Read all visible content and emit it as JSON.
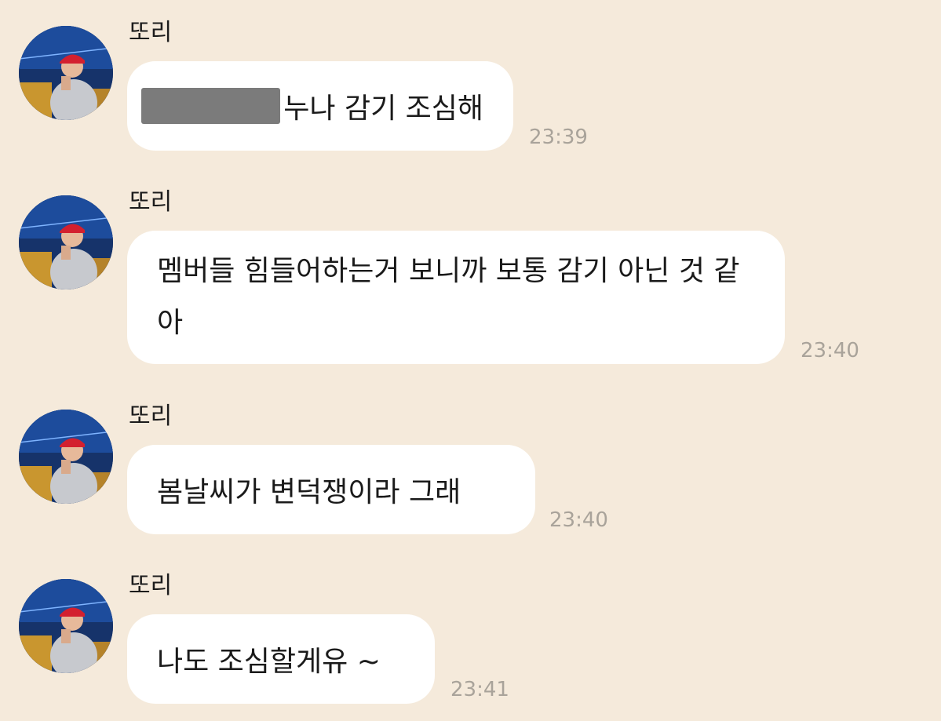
{
  "chat": {
    "colors": {
      "background": "#f5eadb",
      "bubble": "#ffffff",
      "text": "#1a1a1a",
      "timestamp": "#a9a39a",
      "redaction": "#7b7b7b"
    },
    "messages": [
      {
        "sender": "또리",
        "text": "누나 감기 조심해",
        "time": "23:39",
        "redacted_prefix": true
      },
      {
        "sender": "또리",
        "text": "멤버들 힘들어하는거 보니까 보통 감기 아닌 것 같아",
        "time": "23:40"
      },
      {
        "sender": "또리",
        "text": "봄날씨가 변덕쟁이라 그래",
        "time": "23:40"
      },
      {
        "sender": "또리",
        "text": "나도 조심할게유 ~",
        "time": "23:41"
      }
    ]
  }
}
